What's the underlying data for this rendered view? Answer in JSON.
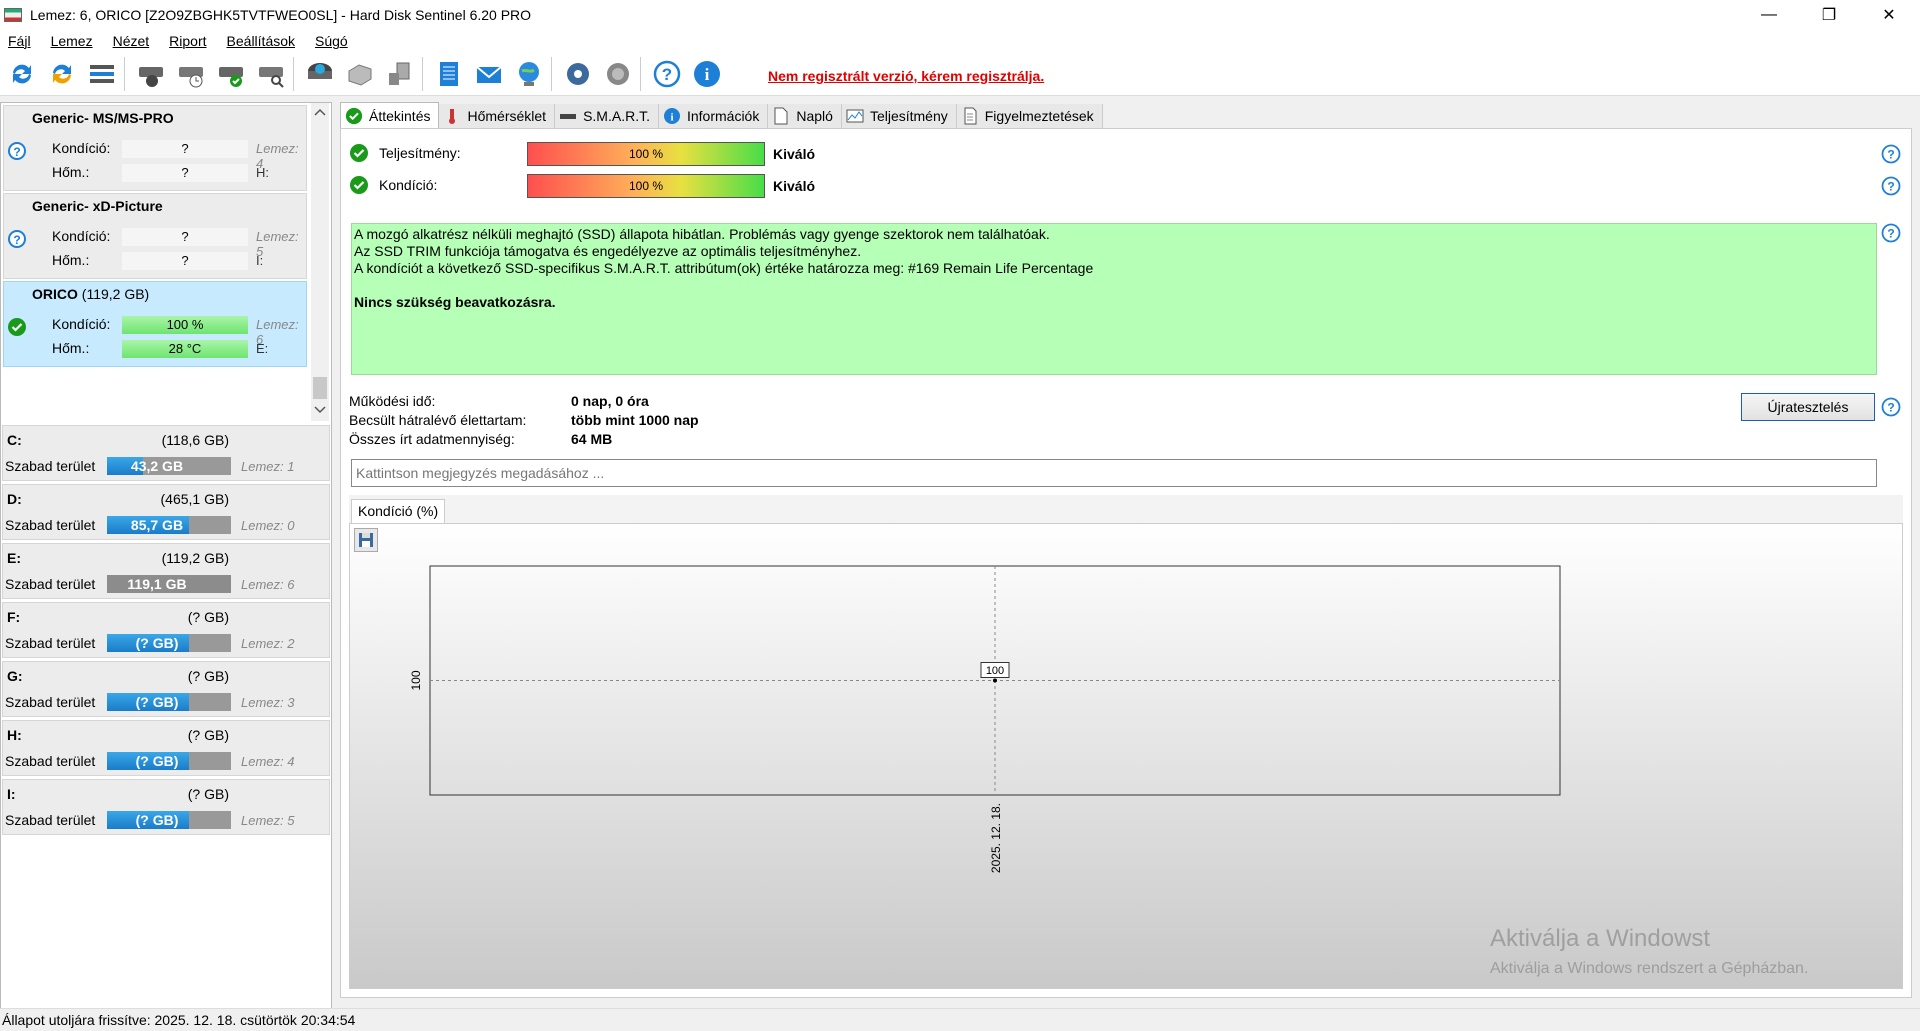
{
  "window": {
    "title": "Lemez: 6, ORICO [Z2O9ZBGHK5TVTFWEO0SL]  -  Hard Disk Sentinel 6.20 PRO",
    "controls": {
      "minimize": "—",
      "maximize": "❐",
      "close": "✕"
    }
  },
  "menu": [
    "Fájl",
    "Lemez",
    "Nézet",
    "Riport",
    "Beállítások",
    "Súgó"
  ],
  "toolbar": {
    "icons": [
      "refresh-icon",
      "refresh-all-icon",
      "disk-list-icon",
      "disk-test-icon",
      "disk-timer-icon",
      "disk-ok-icon",
      "disk-search-icon",
      "disk-drive-icon",
      "printer-icon",
      "network-icon",
      "report-icon",
      "mail-icon",
      "web-icon",
      "settings-icon",
      "sound-icon",
      "help-icon",
      "info-icon"
    ],
    "unregistered": "Nem regisztrált verzió, kérem regisztrálja."
  },
  "disks": [
    {
      "name": "Generic- MS/MS-PRO",
      "size": "",
      "condition_label": "Kondíció:",
      "condition": "?",
      "temp_label": "Hőm.:",
      "temp": "?",
      "disk_no": "Lemez: 4",
      "letter": "H:",
      "status": "unknown"
    },
    {
      "name": "Generic- xD-Picture",
      "size": "",
      "condition_label": "Kondíció:",
      "condition": "?",
      "temp_label": "Hőm.:",
      "temp": "?",
      "disk_no": "Lemez: 5",
      "letter": "I:",
      "status": "unknown"
    },
    {
      "name": "ORICO",
      "size": "(119,2 GB)",
      "condition_label": "Kondíció:",
      "condition": "100 %",
      "temp_label": "Hőm.:",
      "temp": "28 °C",
      "disk_no": "Lemez: 6",
      "letter": "E:",
      "status": "ok"
    }
  ],
  "partitions": [
    {
      "letter": "C:",
      "size": "(118,6 GB)",
      "free_label": "Szabad terület",
      "free": "43,2 GB",
      "disk": "Lemez: 1",
      "fill_pct": 0.36,
      "gray": false
    },
    {
      "letter": "D:",
      "size": "(465,1 GB)",
      "free_label": "Szabad terület",
      "free": "85,7 GB",
      "disk": "Lemez: 0",
      "fill_pct": 0.82,
      "gray": false
    },
    {
      "letter": "E:",
      "size": "(119,2 GB)",
      "free_label": "Szabad terület",
      "free": "119,1 GB",
      "disk": "Lemez: 6",
      "fill_pct": 0.0,
      "gray": true
    },
    {
      "letter": "F:",
      "size": "(? GB)",
      "free_label": "Szabad terület",
      "free": "(? GB)",
      "disk": "Lemez: 2",
      "fill_pct": 0.82,
      "gray": false
    },
    {
      "letter": "G:",
      "size": "(? GB)",
      "free_label": "Szabad terület",
      "free": "(? GB)",
      "disk": "Lemez: 3",
      "fill_pct": 0.82,
      "gray": false
    },
    {
      "letter": "H:",
      "size": "(? GB)",
      "free_label": "Szabad terület",
      "free": "(? GB)",
      "disk": "Lemez: 4",
      "fill_pct": 0.82,
      "gray": false
    },
    {
      "letter": "I:",
      "size": "(? GB)",
      "free_label": "Szabad terület",
      "free": "(? GB)",
      "disk": "Lemez: 5",
      "fill_pct": 0.82,
      "gray": false
    }
  ],
  "tabs": [
    {
      "label": "Áttekintés",
      "icon": "check-icon",
      "active": true
    },
    {
      "label": "Hőmérséklet",
      "icon": "thermometer-icon",
      "active": false
    },
    {
      "label": "S.M.A.R.T.",
      "icon": "smart-icon",
      "active": false
    },
    {
      "label": "Információk",
      "icon": "info-icon",
      "active": false
    },
    {
      "label": "Napló",
      "icon": "log-icon",
      "active": false
    },
    {
      "label": "Teljesítmény",
      "icon": "performance-icon",
      "active": false
    },
    {
      "label": "Figyelmeztetések",
      "icon": "alert-icon",
      "active": false
    }
  ],
  "overview": {
    "performance_label": "Teljesítmény:",
    "performance": "100 %",
    "performance_pct": 1.0,
    "performance_result": "Kiváló",
    "condition_label": "Kondíció:",
    "condition": "100 %",
    "condition_pct": 1.0,
    "condition_result": "Kiváló",
    "info_lines": [
      "A mozgó alkatrész nélküli meghajtó (SSD) állapota hibátlan. Problémás vagy gyenge szektorok nem találhatóak.",
      "Az SSD TRIM funkciója támogatva és engedélyezve az optimális teljesítményhez.",
      "A kondíciót a következő SSD-specifikus S.M.A.R.T. attribútum(ok) értéke határozza meg:  #169 Remain Life Percentage"
    ],
    "info_action": "Nincs szükség beavatkozásra.",
    "uptime_label": "Működési idő:",
    "uptime": "0 nap, 0 óra",
    "lifetime_label": "Becsült hátralévő élettartam:",
    "lifetime": "több mint 1000 nap",
    "written_label": "Összes írt adatmennyiség:",
    "written": "64 MB",
    "reset_button": "Újratesztelés",
    "note_placeholder": "Kattintson megjegyzés megadásához ..."
  },
  "chart_tab": "Kondíció  (%)",
  "chart_data": {
    "type": "line",
    "x": [
      "2025. 12. 18."
    ],
    "series": [
      {
        "values": [
          100
        ]
      }
    ],
    "data_labels": [
      "100"
    ],
    "ylabel": "",
    "y_tick_labels": [
      "100"
    ],
    "x_tick_labels": [
      "2025. 12. 18."
    ],
    "grid": true
  },
  "watermark": {
    "line1": "Aktiválja a Windowst",
    "line2": "Aktiválja a Windows rendszert a Gépházban."
  },
  "status_bar": "Állapot utoljára frissítve: 2025. 12. 18. csütörtök 20:34:54"
}
